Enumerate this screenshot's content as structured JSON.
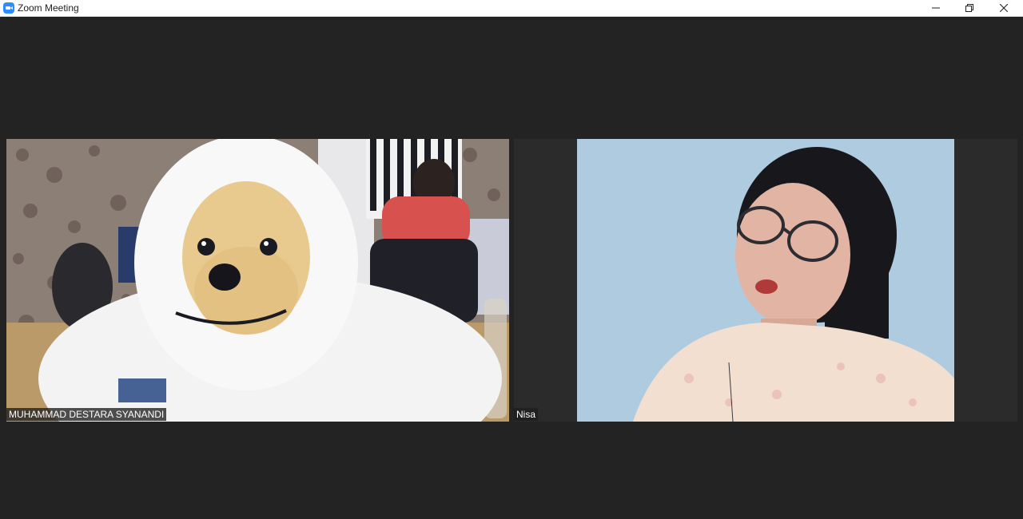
{
  "window": {
    "title": "Zoom Meeting",
    "controls": {
      "minimize": "minimize-icon",
      "restore": "restore-icon",
      "close": "close-icon"
    }
  },
  "participants": [
    {
      "name": "MUHAMMAD DESTARA SYANANDI"
    },
    {
      "name": "Nisa"
    }
  ],
  "colors": {
    "background": "#232323",
    "tile_background": "#2b2b2b",
    "brand": "#2d8cff"
  }
}
